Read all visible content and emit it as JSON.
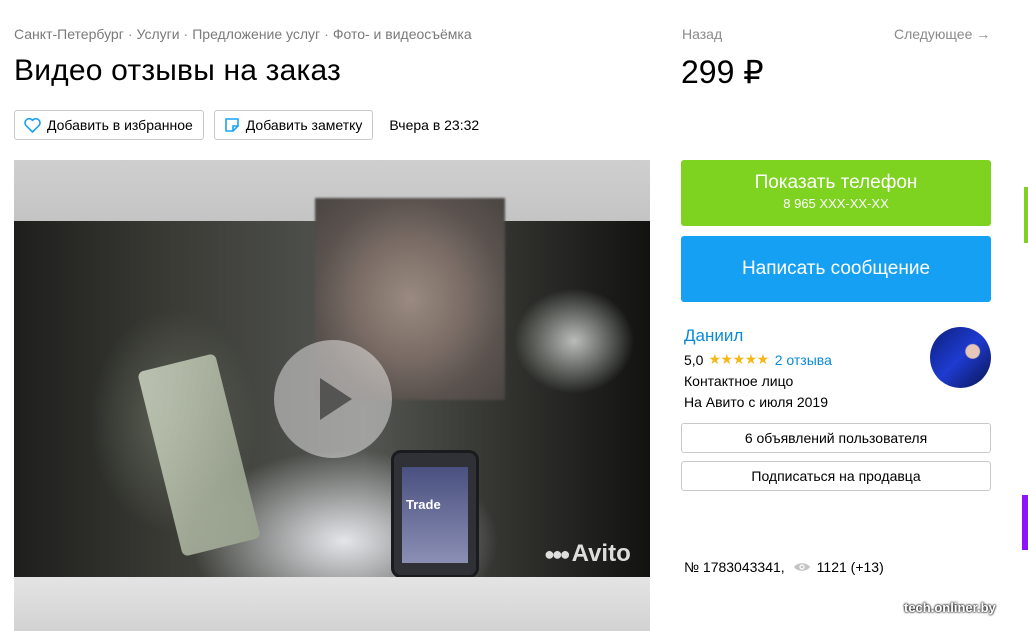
{
  "breadcrumb": [
    "Санкт-Петербург",
    "Услуги",
    "Предложение услуг",
    "Фото- и видеосъёмка"
  ],
  "breadcrumb_sep": "·",
  "title": "Видео отзывы на заказ",
  "actions": {
    "favorite_label": "Добавить в избранное",
    "note_label": "Добавить заметку",
    "date": "Вчера в 23:32"
  },
  "gallery": {
    "phone_text": "Trade",
    "watermark": "Avito"
  },
  "nav": {
    "back": "Назад",
    "next": "Следующее →"
  },
  "price": "299 ₽",
  "contact": {
    "phone_button": "Показать телефон",
    "phone_masked": "8 965 XXX-XX-XX",
    "message_button": "Написать сообщение"
  },
  "seller": {
    "name": "Даниил",
    "rating": "5,0",
    "stars": "★★★★★",
    "stars_value": 5,
    "reviews": "2 отзыва",
    "role": "Контактное лицо",
    "since": "На Авито с июля 2019"
  },
  "seller_buttons": {
    "listings": "6 объявлений пользователя",
    "subscribe": "Подписаться на продавца"
  },
  "meta": {
    "ad_number": "№ 1783043341,",
    "views": "1121 (+13)"
  },
  "colors": {
    "phone_button": "#7ed321",
    "message_button": "#16a0f4",
    "link": "#0a8ad6",
    "star": "#f6b818"
  },
  "site_watermark": "tech.onliner.by"
}
